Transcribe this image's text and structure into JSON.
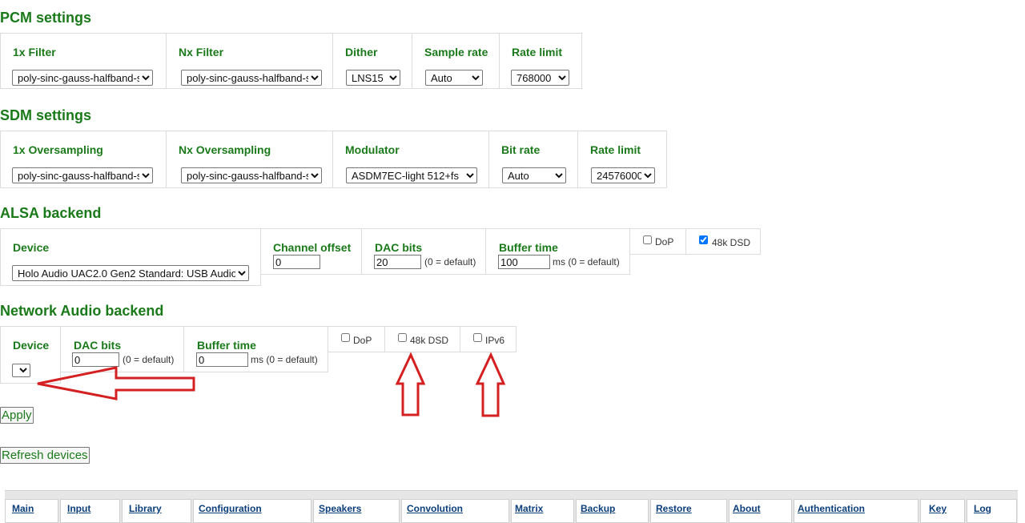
{
  "pcm": {
    "title": "PCM settings",
    "filter1x": {
      "label": "1x Filter",
      "value": "poly-sinc-gauss-halfband-s"
    },
    "filterNx": {
      "label": "Nx Filter",
      "value": "poly-sinc-gauss-halfband-s"
    },
    "dither": {
      "label": "Dither",
      "value": "LNS15"
    },
    "sample_rate": {
      "label": "Sample rate",
      "value": "Auto"
    },
    "rate_limit": {
      "label": "Rate limit",
      "value": "768000"
    }
  },
  "sdm": {
    "title": "SDM settings",
    "oversampling1x": {
      "label": "1x Oversampling",
      "value": "poly-sinc-gauss-halfband-s"
    },
    "oversamplingNx": {
      "label": "Nx Oversampling",
      "value": "poly-sinc-gauss-halfband-s"
    },
    "modulator": {
      "label": "Modulator",
      "value": "ASDM7EC-light 512+fs"
    },
    "bit_rate": {
      "label": "Bit rate",
      "value": "Auto"
    },
    "rate_limit": {
      "label": "Rate limit",
      "value": "24576000"
    }
  },
  "alsa": {
    "title": "ALSA backend",
    "device": {
      "label": "Device",
      "value": "Holo Audio UAC2.0 Gen2 Standard: USB Audio"
    },
    "channel_offset": {
      "label": "Channel offset",
      "value": "0"
    },
    "dac_bits": {
      "label": "DAC bits",
      "value": "20",
      "hint": "(0 = default)"
    },
    "buffer_time": {
      "label": "Buffer time",
      "value": "100",
      "hint": "ms (0 = default)"
    },
    "dop": {
      "label": "DoP",
      "checked": false
    },
    "dsd48k": {
      "label": "48k DSD",
      "checked": true
    }
  },
  "network": {
    "title": "Network Audio backend",
    "device": {
      "label": "Device",
      "value": ""
    },
    "dac_bits": {
      "label": "DAC bits",
      "value": "0",
      "hint": "(0 = default)"
    },
    "buffer_time": {
      "label": "Buffer time",
      "value": "0",
      "hint": "ms (0 = default)"
    },
    "dop": {
      "label": "DoP",
      "checked": false
    },
    "dsd48k": {
      "label": "48k DSD",
      "checked": false
    },
    "ipv6": {
      "label": "IPv6",
      "checked": false
    }
  },
  "buttons": {
    "apply": "Apply",
    "refresh": "Refresh devices"
  },
  "nav": [
    "Main",
    "Input",
    "Library",
    "Configuration",
    "Speakers",
    "Convolution",
    "Matrix",
    "Backup",
    "Restore",
    "About",
    "Authentication",
    "Key",
    "Log"
  ],
  "colors": {
    "label_green": "#1a7a1a",
    "annotation_red": "#d42020",
    "nav_link": "#0b3e7a"
  }
}
